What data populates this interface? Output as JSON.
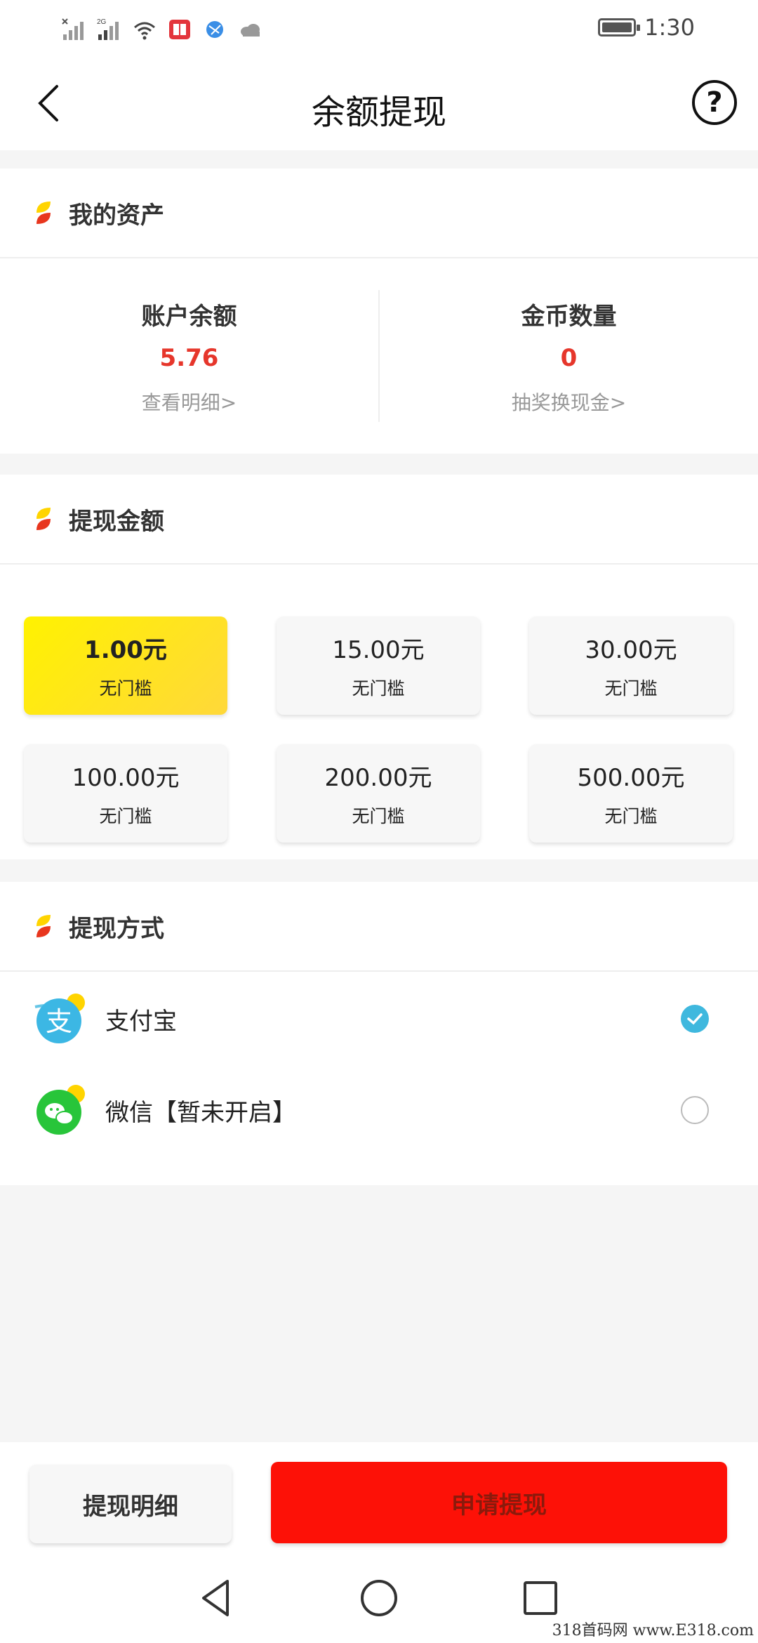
{
  "status_bar": {
    "time": "1:30",
    "network": "2G"
  },
  "header": {
    "title": "余额提现",
    "help_symbol": "?"
  },
  "assets": {
    "title": "我的资产",
    "balance_label": "账户余额",
    "balance_value": "5.76",
    "balance_link": "查看明细>",
    "coins_label": "金币数量",
    "coins_value": "0",
    "coins_link": "抽奖换现金>"
  },
  "withdraw_amount": {
    "title": "提现金额",
    "options": [
      {
        "amount": "1.00元",
        "note": "无门槛",
        "selected": true
      },
      {
        "amount": "15.00元",
        "note": "无门槛"
      },
      {
        "amount": "30.00元",
        "note": "无门槛"
      },
      {
        "amount": "100.00元",
        "note": "无门槛"
      },
      {
        "amount": "200.00元",
        "note": "无门槛"
      },
      {
        "amount": "500.00元",
        "note": "无门槛"
      }
    ]
  },
  "withdraw_method": {
    "title": "提现方式",
    "methods": [
      {
        "label": "支付宝",
        "icon": "alipay-icon",
        "checked": true
      },
      {
        "label": "微信【暂未开启】",
        "icon": "wechat-icon",
        "checked": false
      }
    ]
  },
  "bottom": {
    "detail_label": "提现明细",
    "apply_label": "申请提现"
  },
  "watermark": "318首码网 www.E318.com",
  "colors": {
    "accent_red": "#fd1107",
    "value_red": "#e6362b",
    "selected_yellow": "#fff200",
    "radio_blue": "#3fb8de"
  }
}
